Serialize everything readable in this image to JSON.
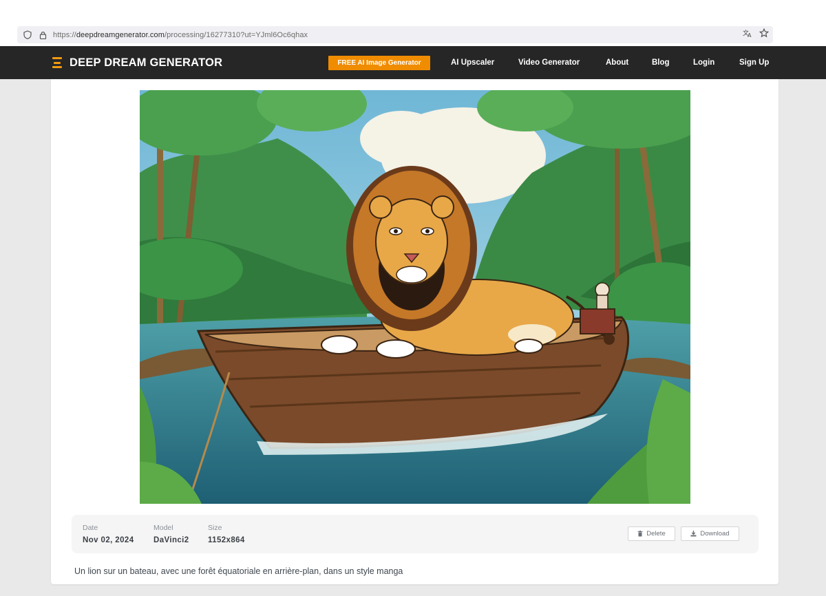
{
  "browser": {
    "url_prefix": "https://",
    "url_host": "deepdreamgenerator.com",
    "url_path": "/processing/16277310?ut=YJml6Oc6qhax"
  },
  "nav": {
    "brand": "DEEP DREAM GENERATOR",
    "cta": "FREE AI Image Generator",
    "links": [
      "AI Upscaler",
      "Video Generator",
      "About",
      "Blog",
      "Login",
      "Sign Up"
    ]
  },
  "colors": {
    "nav_bg": "#262626",
    "accent": "#f08c00",
    "page_bg": "#e9e9e9"
  },
  "info": {
    "date_label": "Date",
    "date_value": "Nov 02, 2024",
    "model_label": "Model",
    "model_value": "DaVinci2",
    "size_label": "Size",
    "size_value": "1152x864",
    "delete_label": "Delete",
    "download_label": "Download"
  },
  "caption": "Un lion sur un bateau, avec une forêt équatoriale en arrière-plan, dans un style manga"
}
